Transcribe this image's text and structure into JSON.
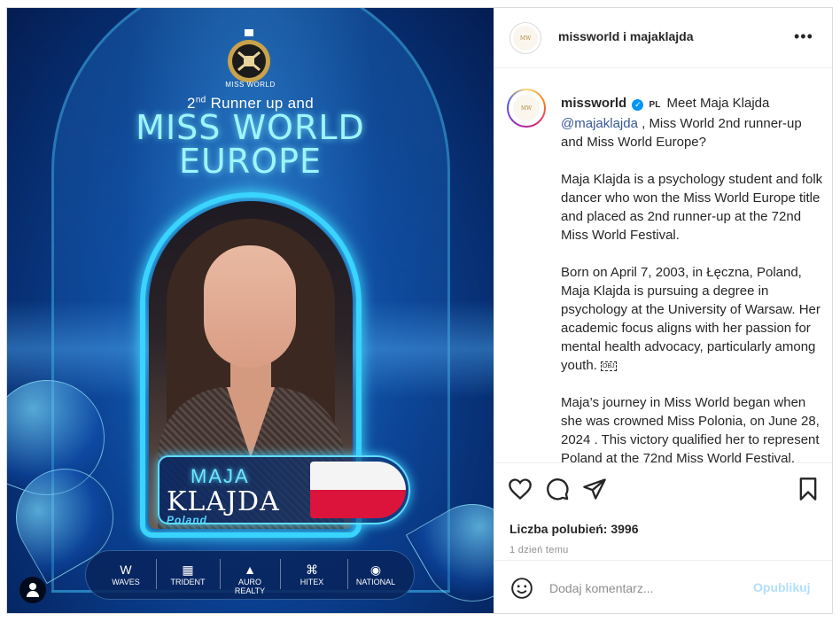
{
  "media": {
    "crest_text": "MISS WORLD",
    "subtitle_pre": "2",
    "subtitle_sup": "nd",
    "subtitle_post": " Runner up and",
    "title_line1": "MISS WORLD",
    "title_line2": "EUROPE",
    "first_name": "MAJA",
    "last_name": "KLAJDA",
    "country": "Poland",
    "sponsors": [
      {
        "glyph": "W",
        "label": "WAVES"
      },
      {
        "glyph": "▦",
        "label": "TRIDENT"
      },
      {
        "glyph": "▲",
        "label": "AURO REALTY"
      },
      {
        "glyph": "⌘",
        "label": "HITEX"
      },
      {
        "glyph": "◉",
        "label": "NATIONAL"
      }
    ]
  },
  "header": {
    "title": "missworld i majaklajda",
    "more_label": "•••"
  },
  "caption": {
    "username": "missworld",
    "verified_mark": "✓",
    "lang_flag": "PL",
    "intro": " Meet Maja Klajda ",
    "mention": "@majaklajda",
    "intro_rest": " , Miss World 2nd runner-up and Miss World Europe?",
    "para1": "Maja Klajda is a psychology student and folk dancer who won the Miss World Europe title and placed as 2nd runner-up at the 72nd Miss World Festival.",
    "para2": "Born on April 7, 2003, in Łęczna, Poland, Maja Klajda is pursuing a degree in psychology at the University of Warsaw. Her academic focus aligns with her passion for mental health advocacy, particularly among youth.",
    "obj_marker": "OBJ",
    "para3": "Maja’s journey in Miss World began when she was crowned Miss Polonia, on June 28, 2024 . This victory qualified her to represent Poland at the 72nd Miss World Festival."
  },
  "stats": {
    "likes": "Liczba polubień: 3996",
    "time": "1 dzień temu"
  },
  "comment": {
    "placeholder": "Dodaj komentarz...",
    "post_label": "Opublikuj"
  },
  "colors": {
    "link": "#385898",
    "verified": "#0095f6",
    "post_disabled": "#b2dffc"
  }
}
